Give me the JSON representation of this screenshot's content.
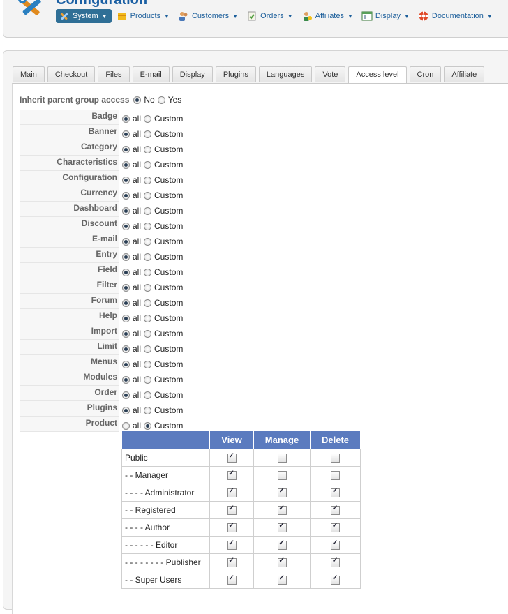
{
  "header": {
    "title": "Configuration",
    "menu": [
      {
        "label": "System",
        "icon": "wrench-icon",
        "active": true
      },
      {
        "label": "Products",
        "icon": "box-icon",
        "active": false
      },
      {
        "label": "Customers",
        "icon": "users-icon",
        "active": false
      },
      {
        "label": "Orders",
        "icon": "orders-icon",
        "active": false
      },
      {
        "label": "Affiliates",
        "icon": "affiliate-icon",
        "active": false
      },
      {
        "label": "Display",
        "icon": "display-icon",
        "active": false
      },
      {
        "label": "Documentation",
        "icon": "lifebuoy-icon",
        "active": false
      }
    ]
  },
  "tabs": [
    {
      "label": "Main",
      "active": false
    },
    {
      "label": "Checkout",
      "active": false
    },
    {
      "label": "Files",
      "active": false
    },
    {
      "label": "E-mail",
      "active": false
    },
    {
      "label": "Display",
      "active": false
    },
    {
      "label": "Plugins",
      "active": false
    },
    {
      "label": "Languages",
      "active": false
    },
    {
      "label": "Vote",
      "active": false
    },
    {
      "label": "Access level",
      "active": true
    },
    {
      "label": "Cron",
      "active": false
    },
    {
      "label": "Affiliate",
      "active": false
    }
  ],
  "inherit": {
    "label": "Inherit parent group access",
    "options": [
      "No",
      "Yes"
    ],
    "selected": "No"
  },
  "option_labels": {
    "all": "all",
    "custom": "Custom"
  },
  "access_rows": [
    {
      "label": "Badge",
      "value": "all"
    },
    {
      "label": "Banner",
      "value": "all"
    },
    {
      "label": "Category",
      "value": "all"
    },
    {
      "label": "Characteristics",
      "value": "all"
    },
    {
      "label": "Configuration",
      "value": "all"
    },
    {
      "label": "Currency",
      "value": "all"
    },
    {
      "label": "Dashboard",
      "value": "all"
    },
    {
      "label": "Discount",
      "value": "all"
    },
    {
      "label": "E-mail",
      "value": "all"
    },
    {
      "label": "Entry",
      "value": "all"
    },
    {
      "label": "Field",
      "value": "all"
    },
    {
      "label": "Filter",
      "value": "all"
    },
    {
      "label": "Forum",
      "value": "all"
    },
    {
      "label": "Help",
      "value": "all"
    },
    {
      "label": "Import",
      "value": "all"
    },
    {
      "label": "Limit",
      "value": "all"
    },
    {
      "label": "Menus",
      "value": "all"
    },
    {
      "label": "Modules",
      "value": "all"
    },
    {
      "label": "Order",
      "value": "all"
    },
    {
      "label": "Plugins",
      "value": "all"
    },
    {
      "label": "Product",
      "value": "custom"
    }
  ],
  "permissions": {
    "columns": [
      "View",
      "Manage",
      "Delete"
    ],
    "groups": [
      {
        "name": "Public",
        "view": true,
        "manage": false,
        "delete": false
      },
      {
        "name": "- - Manager",
        "view": true,
        "manage": false,
        "delete": false
      },
      {
        "name": "- - - - Administrator",
        "view": true,
        "manage": true,
        "delete": true
      },
      {
        "name": "- - Registered",
        "view": true,
        "manage": true,
        "delete": true
      },
      {
        "name": "- - - - Author",
        "view": true,
        "manage": true,
        "delete": true
      },
      {
        "name": "- - - - - - Editor",
        "view": true,
        "manage": true,
        "delete": true
      },
      {
        "name": "- - - - - - - - Publisher",
        "view": true,
        "manage": true,
        "delete": true
      },
      {
        "name": "- - Super Users",
        "view": true,
        "manage": true,
        "delete": true
      }
    ]
  },
  "colors": {
    "title": "#1a5fa3",
    "menu_active_bg": "#2f6f96",
    "table_header_bg": "#5b7bbf"
  }
}
